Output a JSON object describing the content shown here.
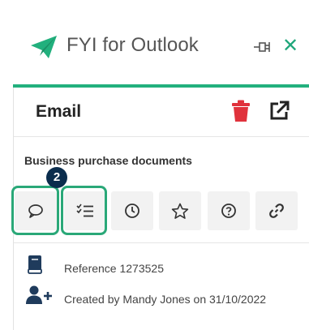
{
  "app": {
    "title": "FYI for Outlook",
    "brand_color": "#22b07d"
  },
  "header": {
    "pin_icon": "pin-icon",
    "close_icon": "close-icon",
    "close_label": "✕"
  },
  "email": {
    "title": "Email",
    "subject": "Business purchase documents",
    "delete_icon": "trash-icon",
    "open_icon": "open-external-icon"
  },
  "callout": {
    "badge": "2"
  },
  "toolbar": {
    "buttons": [
      {
        "icon": "comment-icon"
      },
      {
        "icon": "task-list-icon"
      },
      {
        "icon": "clock-icon"
      },
      {
        "icon": "star-icon"
      },
      {
        "icon": "help-icon"
      },
      {
        "icon": "link-icon"
      }
    ]
  },
  "details": {
    "reference": "Reference 1273525",
    "created": "Created by Mandy Jones on 31/10/2022"
  }
}
